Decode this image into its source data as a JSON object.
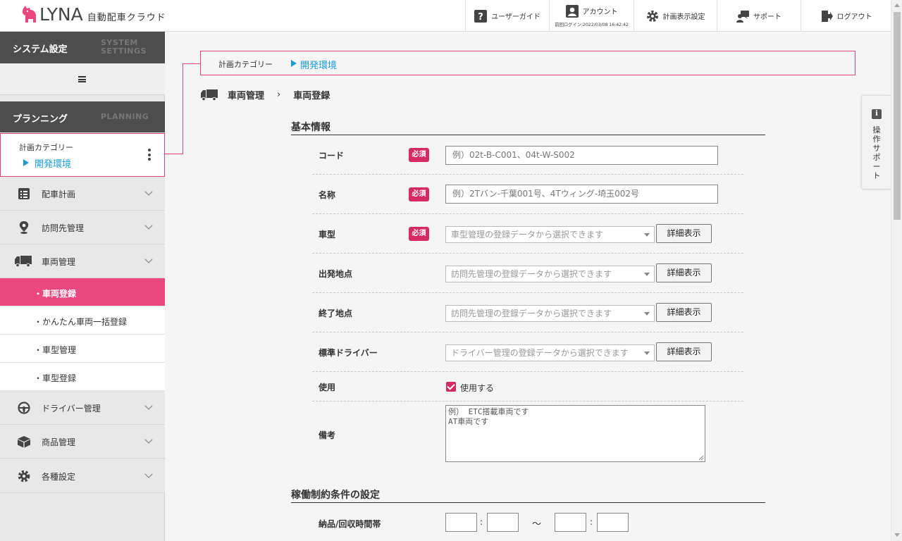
{
  "header": {
    "logo_text": "LYNA",
    "app_name": "自動配車クラウド",
    "buttons": {
      "user_guide": "ユーザーガイド",
      "account": "アカウント",
      "last_login": "前回ログイン:2022/03/08 16:42:42",
      "plan_display_settings": "計画表示設定",
      "support": "サポート",
      "logout": "ログアウト"
    }
  },
  "sidebar": {
    "system_tab": {
      "jp": "システム設定",
      "en_line1": "SYSTEM",
      "en_line2": "SETTINGS"
    },
    "planning_tab": {
      "jp": "プランニング",
      "en": "PLANNING"
    },
    "plan_category": {
      "label": "計画カテゴリー",
      "value": "開発環境"
    },
    "items": [
      {
        "label": "配車計画",
        "icon": "list-icon"
      },
      {
        "label": "訪問先管理",
        "icon": "map-pin-icon"
      },
      {
        "label": "車両管理",
        "icon": "truck-icon"
      },
      {
        "label": "ドライバー管理",
        "icon": "steering-wheel-icon"
      },
      {
        "label": "商品管理",
        "icon": "box-icon"
      },
      {
        "label": "各種設定",
        "icon": "gear-icon"
      }
    ],
    "vehicle_sub": [
      {
        "label": "・車両登録",
        "active": true
      },
      {
        "label": "・かんたん車両一括登録",
        "active": false
      },
      {
        "label": "・車型管理",
        "active": false
      },
      {
        "label": "・車型登録",
        "active": false
      }
    ]
  },
  "category_box": {
    "label": "計画カテゴリー",
    "value": "開発環境"
  },
  "breadcrumb": {
    "parent": "車両管理",
    "separator": "›",
    "current": "車両登録"
  },
  "form": {
    "basic_info_title": "基本情報",
    "required_badge": "必須",
    "detail_button": "詳細表示",
    "code": {
      "label": "コード",
      "placeholder": "例）02t-B-C001、04t-W-S002"
    },
    "name": {
      "label": "名称",
      "placeholder": "例）2Tバン-千葉001号、4Tウィング-埼玉002号"
    },
    "vehicle_type": {
      "label": "車型",
      "placeholder": "車型管理の登録データから選択できます"
    },
    "start_point": {
      "label": "出発地点",
      "placeholder": "訪問先管理の登録データから選択できます"
    },
    "end_point": {
      "label": "終了地点",
      "placeholder": "訪問先管理の登録データから選択できます"
    },
    "default_driver": {
      "label": "標準ドライバー",
      "placeholder": "ドライバー管理の登録データから選択できます"
    },
    "use": {
      "label": "使用",
      "checkbox_label": "使用する",
      "checked": true
    },
    "remarks": {
      "label": "備考",
      "placeholder": "例） ETC搭載車両です\nAT車両です"
    },
    "constraints_title": "稼働制約条件の設定",
    "time_window": {
      "label": "納品/回収時間帯",
      "colon": ":",
      "tilde": "～"
    }
  },
  "side_help": {
    "label": "操作サポート"
  },
  "colors": {
    "accent_pink": "#e9477e",
    "required_red": "#d62a63",
    "link_blue": "#1a9ad6",
    "dark_tab": "#4d4d4d"
  }
}
